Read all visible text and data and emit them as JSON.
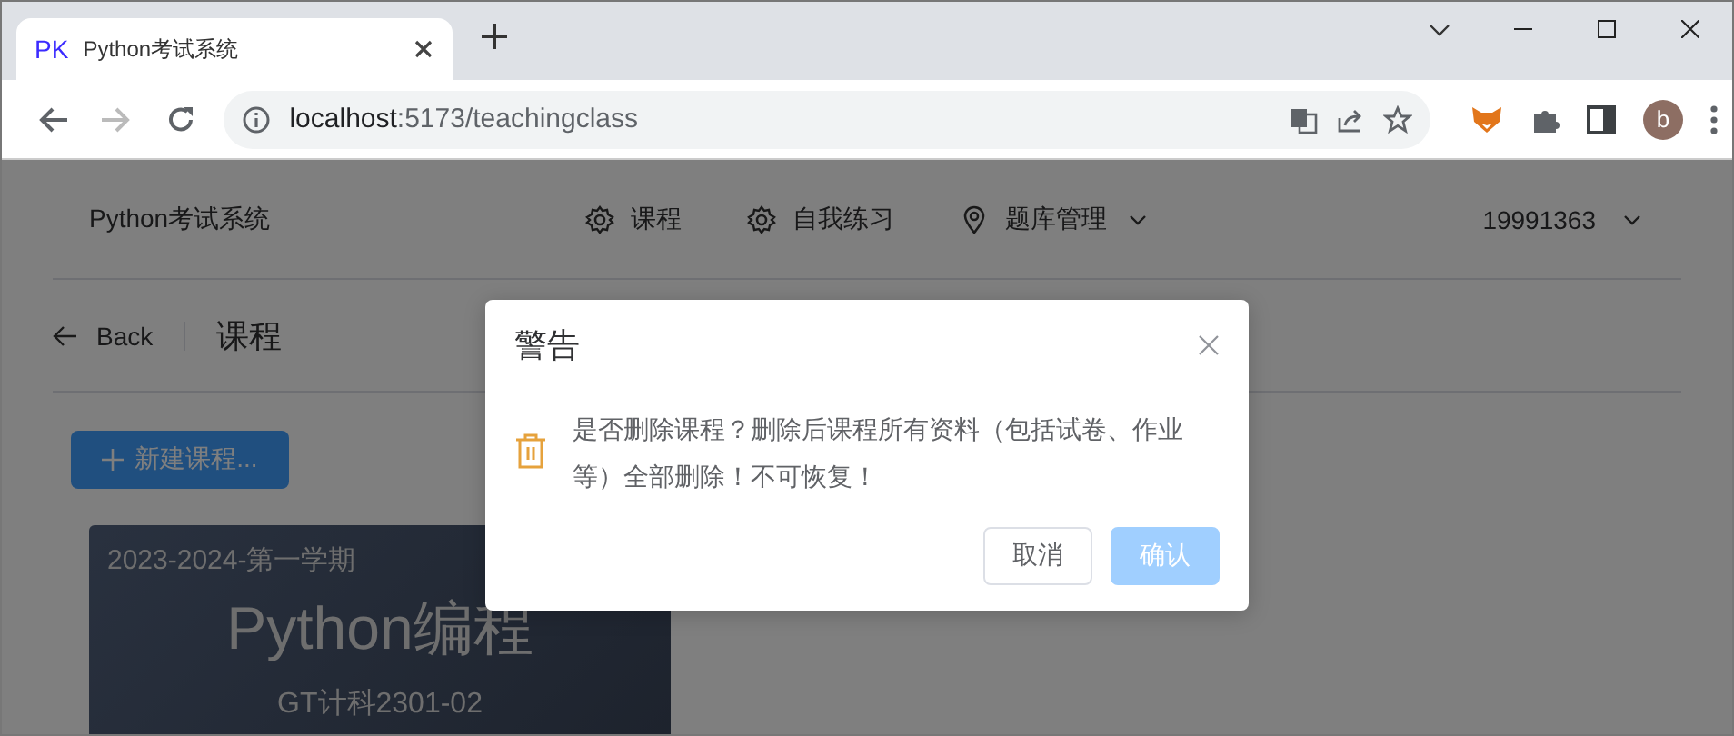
{
  "browser": {
    "tab": {
      "favicon": "PK",
      "title": "Python考试系统"
    },
    "url": {
      "host": "localhost",
      "rest": ":5173/teachingclass"
    },
    "avatar": "b"
  },
  "header": {
    "brand": "Python考试系统",
    "nav": [
      {
        "label": "课程",
        "kind": "gear",
        "dropdown": false
      },
      {
        "label": "自我练习",
        "kind": "gear",
        "dropdown": false
      },
      {
        "label": "题库管理",
        "kind": "pin",
        "dropdown": true
      }
    ],
    "user": "19991363"
  },
  "page": {
    "back": "Back",
    "title": "课程",
    "new_button": "新建课程...",
    "courses": [
      {
        "term": "2023-2024-第一学期",
        "name": "Python编程",
        "class": "GT计科2301-02"
      }
    ]
  },
  "dialog": {
    "title": "警告",
    "message": "是否删除课程？删除后课程所有资料（包括试卷、作业等）全部删除！不可恢复！",
    "buttons": [
      {
        "label": "取消",
        "kind": "default",
        "disabled": false
      },
      {
        "label": "确认",
        "kind": "primary",
        "disabled": true
      }
    ]
  }
}
